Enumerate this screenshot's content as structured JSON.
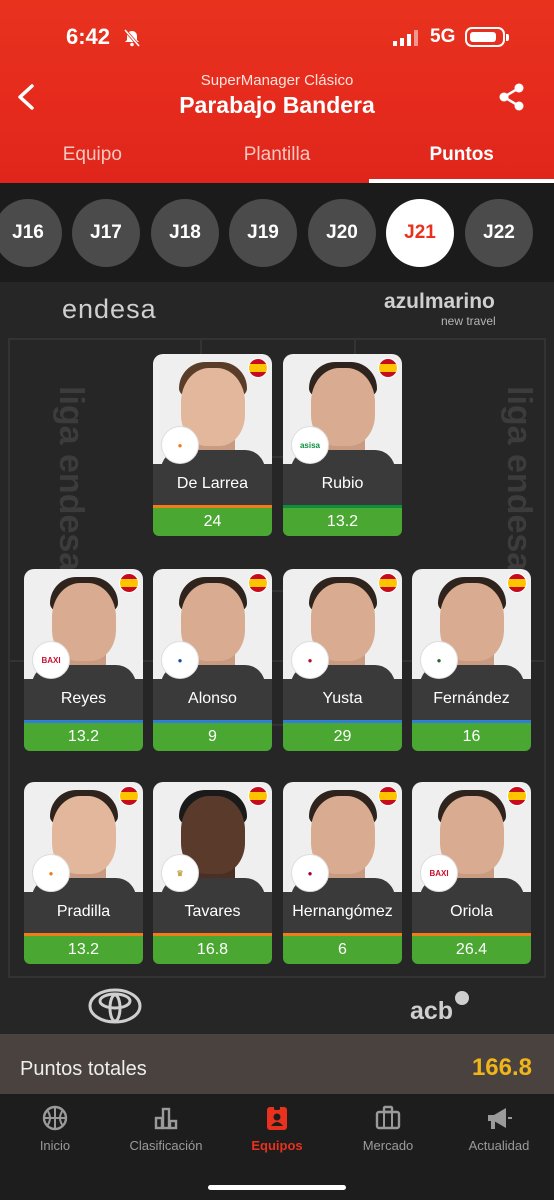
{
  "status_bar": {
    "time": "6:42",
    "network": "5G"
  },
  "header": {
    "subtitle": "SuperManager Clásico",
    "title": "Parabajo Bandera",
    "tabs": [
      {
        "label": "Equipo",
        "active": false
      },
      {
        "label": "Plantilla",
        "active": false
      },
      {
        "label": "Puntos",
        "active": true
      }
    ]
  },
  "rounds": [
    {
      "label": "J16",
      "active": false
    },
    {
      "label": "J17",
      "active": false
    },
    {
      "label": "J18",
      "active": false
    },
    {
      "label": "J19",
      "active": false
    },
    {
      "label": "J20",
      "active": false
    },
    {
      "label": "J21",
      "active": true
    },
    {
      "label": "J22",
      "active": false
    }
  ],
  "court": {
    "sponsors": {
      "top_left": "endesa",
      "top_right": "azulmarino",
      "top_right_sub": "new travel",
      "side": "liga endesa",
      "bottom_right": "acb"
    },
    "players": [
      {
        "name": "De Larrea",
        "points": "24",
        "club": "Valencia"
      },
      {
        "name": "Rubio",
        "points": "13.2",
        "club": "Joventut"
      },
      {
        "name": "Reyes",
        "points": "13.2",
        "club": "BAXI"
      },
      {
        "name": "Alonso",
        "points": "9",
        "club": "Andorra"
      },
      {
        "name": "Yusta",
        "points": "29",
        "club": "Zaragoza"
      },
      {
        "name": "Fernández",
        "points": "16",
        "club": "Obradoiro"
      },
      {
        "name": "Pradilla",
        "points": "13.2",
        "club": "Valencia"
      },
      {
        "name": "Tavares",
        "points": "16.8",
        "club": "Real Madrid"
      },
      {
        "name": "Hernangómez",
        "points": "6",
        "club": "Barça"
      },
      {
        "name": "Oriola",
        "points": "26.4",
        "club": "BAXI"
      }
    ]
  },
  "totals": {
    "label": "Puntos totales",
    "value": "166.8"
  },
  "bottom_nav": [
    {
      "label": "Inicio",
      "icon": "basketball-icon",
      "active": false
    },
    {
      "label": "Clasificación",
      "icon": "bar-chart-icon",
      "active": false
    },
    {
      "label": "Equipos",
      "icon": "badge-icon",
      "active": true
    },
    {
      "label": "Mercado",
      "icon": "briefcase-icon",
      "active": false
    },
    {
      "label": "Actualidad",
      "icon": "megaphone-icon",
      "active": false
    }
  ],
  "colors": {
    "accent": "#e8321e",
    "points_green": "#4aa832",
    "total_yellow": "#f0b51a"
  }
}
